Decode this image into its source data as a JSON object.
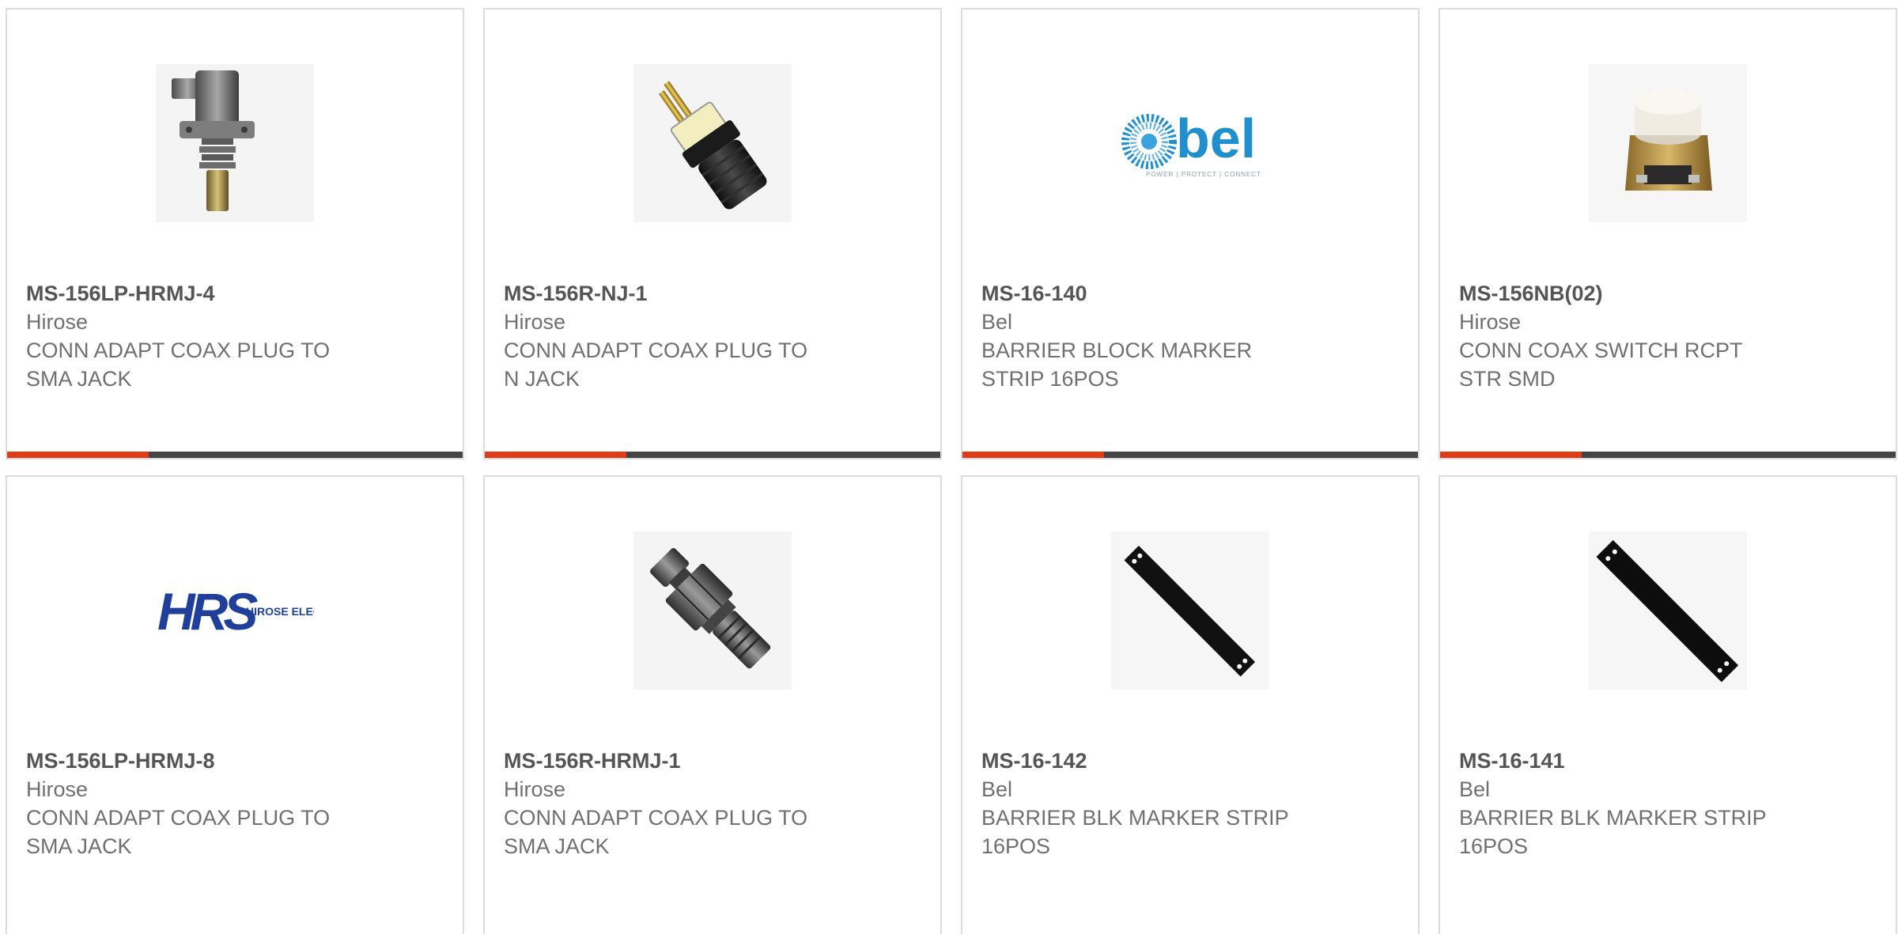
{
  "colors": {
    "accent_bar": "#e03c1a",
    "track_bar": "#444444",
    "card_border": "#dcdcdc",
    "part_number": "#555555",
    "body_text": "#707070"
  },
  "products": [
    {
      "part_number": "MS-156LP-HRMJ-4",
      "manufacturer": "Hirose",
      "description": "CONN ADAPT COAX PLUG TO\nSMA JACK",
      "image_icon": "coax-adapter-flange-icon",
      "progress": 0.31
    },
    {
      "part_number": "MS-156R-NJ-1",
      "manufacturer": "Hirose",
      "description": "CONN ADAPT COAX PLUG TO\nN JACK",
      "image_icon": "coax-n-jack-adapter-icon",
      "progress": 0.31
    },
    {
      "part_number": "MS-16-140",
      "manufacturer": "Bel",
      "description": "BARRIER BLOCK MARKER\nSTRIP 16POS",
      "image_icon": "bel-logo-icon",
      "logo_text": "bel",
      "logo_tagline": "POWER | PROTECT | CONNECT",
      "progress": 0.31
    },
    {
      "part_number": "MS-156NB(02)",
      "manufacturer": "Hirose",
      "description": "CONN COAX SWITCH RCPT\nSTR SMD",
      "image_icon": "coax-switch-receptacle-icon",
      "progress": 0.31
    },
    {
      "part_number": "MS-156LP-HRMJ-8",
      "manufacturer": "Hirose",
      "description": "CONN ADAPT COAX PLUG TO\nSMA JACK",
      "image_icon": "hirose-logo-icon",
      "logo_text": "HRS",
      "logo_tagline": "HIROSE ELECTRIC CO., LTD."
    },
    {
      "part_number": "MS-156R-HRMJ-1",
      "manufacturer": "Hirose",
      "description": "CONN ADAPT COAX PLUG TO\nSMA JACK",
      "image_icon": "coax-sma-adapter-icon"
    },
    {
      "part_number": "MS-16-142",
      "manufacturer": "Bel",
      "description": "BARRIER BLK MARKER STRIP\n16POS",
      "image_icon": "marker-strip-icon"
    },
    {
      "part_number": "MS-16-141",
      "manufacturer": "Bel",
      "description": "BARRIER BLK MARKER STRIP\n16POS",
      "image_icon": "marker-strip-icon"
    }
  ]
}
